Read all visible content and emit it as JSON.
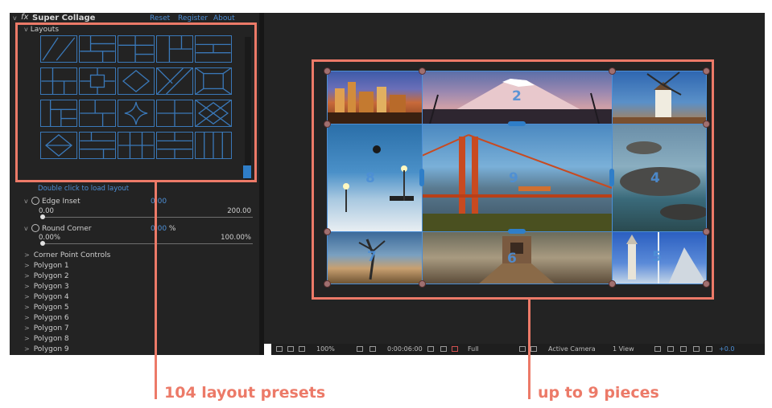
{
  "effect": {
    "tw": "v",
    "fx_symbol": "fx",
    "name": "Super Collage",
    "links": {
      "reset": "Reset",
      "register": "Register",
      "about": "About"
    }
  },
  "layouts": {
    "tw": "v",
    "label": "Layouts",
    "hint": "Double click to load layout"
  },
  "properties": {
    "edge_inset": {
      "tw": "v",
      "name": "Edge Inset",
      "value": "0.00",
      "min": "0.00",
      "max": "200.00"
    },
    "round_corner": {
      "tw": "v",
      "name": "Round Corner",
      "value": "0.00",
      "unit": "%",
      "min": "0.00%",
      "max": "100.00%"
    }
  },
  "groups": [
    {
      "tw": ">",
      "label": "Corner Point Controls"
    },
    {
      "tw": ">",
      "label": "Polygon 1"
    },
    {
      "tw": ">",
      "label": "Polygon 2"
    },
    {
      "tw": ">",
      "label": "Polygon 3"
    },
    {
      "tw": ">",
      "label": "Polygon 4"
    },
    {
      "tw": ">",
      "label": "Polygon 5"
    },
    {
      "tw": ">",
      "label": "Polygon 6"
    },
    {
      "tw": ">",
      "label": "Polygon 7"
    },
    {
      "tw": ">",
      "label": "Polygon 8"
    },
    {
      "tw": ">",
      "label": "Polygon 9"
    }
  ],
  "collage_numbers": [
    "2",
    "4",
    "5",
    "6",
    "7",
    "8",
    "9"
  ],
  "toolbar": {
    "zoom": "100%",
    "timecode": "0:00:06:00",
    "resolution": "Full",
    "camera": "Active Camera",
    "views": "1 View",
    "offset": "+0.0"
  },
  "annotations": {
    "left_caption": "104 layout presets",
    "right_caption": "up to 9 pieces"
  },
  "colors": {
    "accent": "#ec7a68",
    "link_blue": "#4d8fd6",
    "panel_bg": "#232323"
  }
}
